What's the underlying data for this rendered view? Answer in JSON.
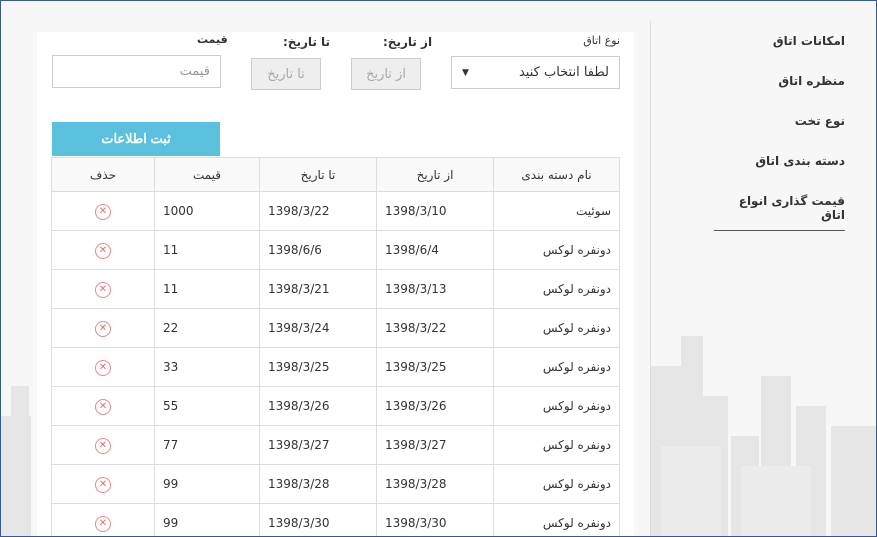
{
  "sidebar": {
    "items": [
      {
        "label": "امکانات اتاق"
      },
      {
        "label": "منظره اتاق"
      },
      {
        "label": "نوع تخت"
      },
      {
        "label": "دسته بندی اتاق"
      },
      {
        "label": "قیمت گذاری انواع اتاق"
      }
    ],
    "active_index": 4
  },
  "form": {
    "room_type_label": "نوع اتاق",
    "room_type_value": "لطفا انتخاب کنید",
    "from_date_label": "از تاریخ:",
    "from_date_placeholder": "از تاریخ",
    "to_date_label": "تا تاریخ:",
    "to_date_placeholder": "تا تاریخ",
    "price_label": "قیمت",
    "price_placeholder": "قیمت",
    "submit_label": "ثبت اطلاعات"
  },
  "table": {
    "headers": [
      "نام دسته بندی",
      "از تاریخ",
      "تا تاریخ",
      "قیمت",
      "حذف"
    ],
    "rows": [
      {
        "name": "سوئیت",
        "from": "1398/3/10",
        "to": "1398/3/22",
        "price": "1000"
      },
      {
        "name": "دونفره لوکس",
        "from": "1398/6/4",
        "to": "1398/6/6",
        "price": "11"
      },
      {
        "name": "دونفره لوکس",
        "from": "1398/3/13",
        "to": "1398/3/21",
        "price": "11"
      },
      {
        "name": "دونفره لوکس",
        "from": "1398/3/22",
        "to": "1398/3/24",
        "price": "22"
      },
      {
        "name": "دونفره لوکس",
        "from": "1398/3/25",
        "to": "1398/3/25",
        "price": "33"
      },
      {
        "name": "دونفره لوکس",
        "from": "1398/3/26",
        "to": "1398/3/26",
        "price": "55"
      },
      {
        "name": "دونفره لوکس",
        "from": "1398/3/27",
        "to": "1398/3/27",
        "price": "77"
      },
      {
        "name": "دونفره لوکس",
        "from": "1398/3/28",
        "to": "1398/3/28",
        "price": "99"
      },
      {
        "name": "دونفره لوکس",
        "from": "1398/3/30",
        "to": "1398/3/30",
        "price": "99"
      }
    ]
  },
  "icons": {
    "delete": "circle-x-icon",
    "caret": "caret-down-icon"
  },
  "colors": {
    "submit": "#5bc0de",
    "delete": "#e07070"
  }
}
